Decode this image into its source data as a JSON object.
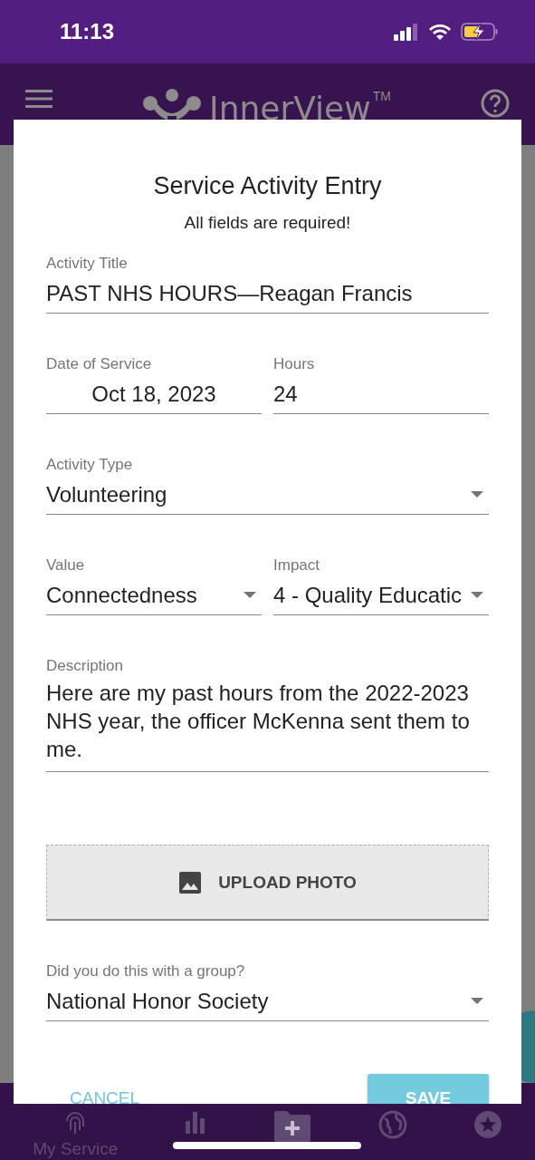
{
  "status_bar": {
    "time": "11:13"
  },
  "app_bar": {
    "title": "InnerView",
    "trademark": "TM"
  },
  "dialog": {
    "title": "Service Activity Entry",
    "subtitle": "All fields are required!",
    "rows": [
      [
        {
          "kind": "text",
          "label": "Activity Title",
          "value": "PAST NHS HOURS—Reagan Francis"
        }
      ],
      [
        {
          "kind": "date",
          "label": "Date of Service",
          "value": "Oct 18, 2023"
        },
        {
          "kind": "text",
          "label": "Hours",
          "value": "24"
        }
      ],
      [
        {
          "kind": "select",
          "label": "Activity Type",
          "value": "Volunteering"
        }
      ],
      [
        {
          "kind": "select",
          "label": "Value",
          "value": "Connectedness"
        },
        {
          "kind": "select",
          "label": "Impact",
          "value": "4 - Quality Educatic"
        }
      ],
      [
        {
          "kind": "multiline",
          "label": "Description",
          "value": "Here are my past hours from the 2022-2023 NHS year, the officer McKenna sent them to me."
        }
      ],
      [
        {
          "kind": "upload",
          "value": "UPLOAD PHOTO"
        }
      ],
      [
        {
          "kind": "select",
          "label": "Did you do this with a group?",
          "value": "National Honor Society"
        }
      ]
    ],
    "buttons": {
      "cancel": "CANCEL",
      "save": "SAVE"
    }
  },
  "bottom_nav": [
    {
      "kind": "fingerprint",
      "label": "My Service"
    },
    {
      "kind": "chart"
    },
    {
      "kind": "folder"
    },
    {
      "kind": "globe"
    },
    {
      "kind": "star"
    }
  ]
}
